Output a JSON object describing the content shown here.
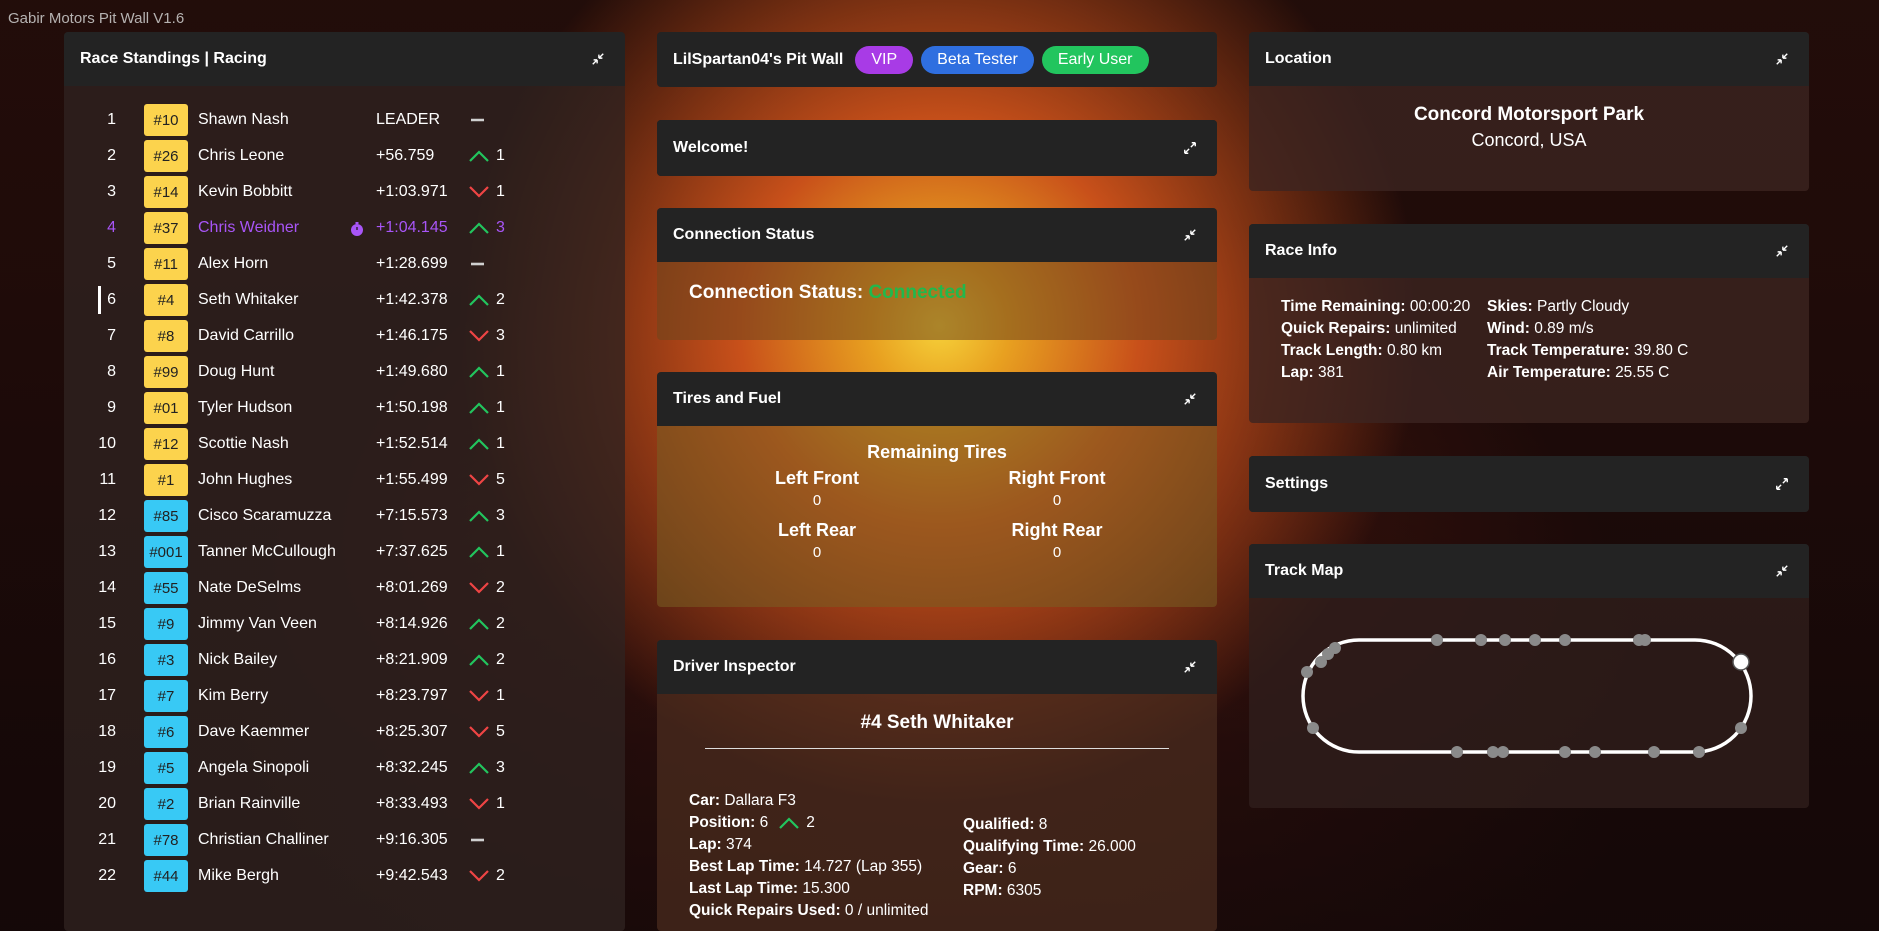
{
  "app_title": "Gabir Motors Pit Wall V1.6",
  "colors": {
    "leader_box": "#fcd34d",
    "gold_box": "#fcd34d",
    "blue_box": "#38c9f5",
    "up": "#22c55e",
    "down": "#ef4444",
    "highlight": "#a855f7",
    "connected": "#22c55e"
  },
  "standings": {
    "title": "Race Standings | Racing",
    "rows": [
      {
        "pos": "1",
        "num": "#10",
        "name": "Shawn Nash",
        "gap": "LEADER",
        "change": "",
        "dir": "none",
        "box": "gold"
      },
      {
        "pos": "2",
        "num": "#26",
        "name": "Chris Leone",
        "gap": "+56.759",
        "change": "1",
        "dir": "up",
        "box": "gold"
      },
      {
        "pos": "3",
        "num": "#14",
        "name": "Kevin Bobbitt",
        "gap": "+1:03.971",
        "change": "1",
        "dir": "down",
        "box": "gold"
      },
      {
        "pos": "4",
        "num": "#37",
        "name": "Chris Weidner",
        "gap": "+1:04.145",
        "change": "3",
        "dir": "up",
        "box": "gold",
        "highlight": true
      },
      {
        "pos": "5",
        "num": "#11",
        "name": "Alex Horn",
        "gap": "+1:28.699",
        "change": "",
        "dir": "none",
        "box": "gold"
      },
      {
        "pos": "6",
        "num": "#4",
        "name": "Seth Whitaker",
        "gap": "+1:42.378",
        "change": "2",
        "dir": "up",
        "box": "gold",
        "selected": true
      },
      {
        "pos": "7",
        "num": "#8",
        "name": "David Carrillo",
        "gap": "+1:46.175",
        "change": "3",
        "dir": "down",
        "box": "gold"
      },
      {
        "pos": "8",
        "num": "#99",
        "name": "Doug Hunt",
        "gap": "+1:49.680",
        "change": "1",
        "dir": "up",
        "box": "gold"
      },
      {
        "pos": "9",
        "num": "#01",
        "name": "Tyler Hudson",
        "gap": "+1:50.198",
        "change": "1",
        "dir": "up",
        "box": "gold"
      },
      {
        "pos": "10",
        "num": "#12",
        "name": "Scottie Nash",
        "gap": "+1:52.514",
        "change": "1",
        "dir": "up",
        "box": "gold"
      },
      {
        "pos": "11",
        "num": "#1",
        "name": "John Hughes",
        "gap": "+1:55.499",
        "change": "5",
        "dir": "down",
        "box": "gold"
      },
      {
        "pos": "12",
        "num": "#85",
        "name": "Cisco Scaramuzza",
        "gap": "+7:15.573",
        "change": "3",
        "dir": "up",
        "box": "blue"
      },
      {
        "pos": "13",
        "num": "#001",
        "name": "Tanner McCullough",
        "gap": "+7:37.625",
        "change": "1",
        "dir": "up",
        "box": "blue"
      },
      {
        "pos": "14",
        "num": "#55",
        "name": "Nate DeSelms",
        "gap": "+8:01.269",
        "change": "2",
        "dir": "down",
        "box": "blue"
      },
      {
        "pos": "15",
        "num": "#9",
        "name": "Jimmy Van Veen",
        "gap": "+8:14.926",
        "change": "2",
        "dir": "up",
        "box": "blue"
      },
      {
        "pos": "16",
        "num": "#3",
        "name": "Nick Bailey",
        "gap": "+8:21.909",
        "change": "2",
        "dir": "up",
        "box": "blue"
      },
      {
        "pos": "17",
        "num": "#7",
        "name": "Kim Berry",
        "gap": "+8:23.797",
        "change": "1",
        "dir": "down",
        "box": "blue"
      },
      {
        "pos": "18",
        "num": "#6",
        "name": "Dave Kaemmer",
        "gap": "+8:25.307",
        "change": "5",
        "dir": "down",
        "box": "blue"
      },
      {
        "pos": "19",
        "num": "#5",
        "name": "Angela Sinopoli",
        "gap": "+8:32.245",
        "change": "3",
        "dir": "up",
        "box": "blue"
      },
      {
        "pos": "20",
        "num": "#2",
        "name": "Brian Rainville",
        "gap": "+8:33.493",
        "change": "1",
        "dir": "down",
        "box": "blue"
      },
      {
        "pos": "21",
        "num": "#78",
        "name": "Christian Challiner",
        "gap": "+9:16.305",
        "change": "",
        "dir": "none",
        "box": "blue"
      },
      {
        "pos": "22",
        "num": "#44",
        "name": "Mike Bergh",
        "gap": "+9:42.543",
        "change": "2",
        "dir": "down",
        "box": "blue"
      }
    ]
  },
  "pitwall": {
    "title": "LilSpartan04's Pit Wall",
    "badges": [
      {
        "label": "VIP",
        "color": "#a83be6"
      },
      {
        "label": "Beta Tester",
        "color": "#2f6fe0"
      },
      {
        "label": "Early User",
        "color": "#22c55e"
      }
    ]
  },
  "welcome": {
    "title": "Welcome!"
  },
  "connection": {
    "title": "Connection Status",
    "label": "Connection Status:",
    "value": "Connected"
  },
  "tires": {
    "title": "Tires and Fuel",
    "heading": "Remaining Tires",
    "lf_label": "Left Front",
    "lf_value": "0",
    "rf_label": "Right Front",
    "rf_value": "0",
    "lr_label": "Left Rear",
    "lr_value": "0",
    "rr_label": "Right Rear",
    "rr_value": "0"
  },
  "inspector": {
    "title": "Driver Inspector",
    "driver": "#4 Seth Whitaker",
    "car_label": "Car:",
    "car": "Dallara F3",
    "position_label": "Position:",
    "position": "6",
    "position_change": "2",
    "lap_label": "Lap:",
    "lap": "374",
    "best_label": "Best Lap Time:",
    "best": "14.727 (Lap 355)",
    "last_label": "Last Lap Time:",
    "last": "15.300",
    "repairs_label": "Quick Repairs Used:",
    "repairs": "0 / unlimited",
    "qualified_label": "Qualified:",
    "qualified": "8",
    "qtime_label": "Qualifying Time:",
    "qtime": "26.000",
    "gear_label": "Gear:",
    "gear": "6",
    "rpm_label": "RPM:",
    "rpm": "6305"
  },
  "location": {
    "title": "Location",
    "track": "Concord Motorsport Park",
    "city": "Concord, USA"
  },
  "race_info": {
    "title": "Race Info",
    "time_label": "Time Remaining:",
    "time": "00:00:20",
    "repairs_label": "Quick Repairs:",
    "repairs": "unlimited",
    "length_label": "Track Length:",
    "length": "0.80 km",
    "lap_label": "Lap:",
    "lap": "381",
    "skies_label": "Skies:",
    "skies": "Partly Cloudy",
    "wind_label": "Wind:",
    "wind": "0.89 m/s",
    "tracktemp_label": "Track Temperature:",
    "tracktemp": "39.80 C",
    "airtemp_label": "Air Temperature:",
    "airtemp": "25.55 C"
  },
  "settings": {
    "title": "Settings"
  },
  "trackmap": {
    "title": "Track Map"
  },
  "icons": {
    "collapse": "collapse-arrows-icon",
    "expand": "expand-arrows-icon",
    "up": "chevron-up-icon",
    "down": "chevron-down-icon",
    "dash": "dash-icon",
    "pit": "pit-timer-icon"
  }
}
